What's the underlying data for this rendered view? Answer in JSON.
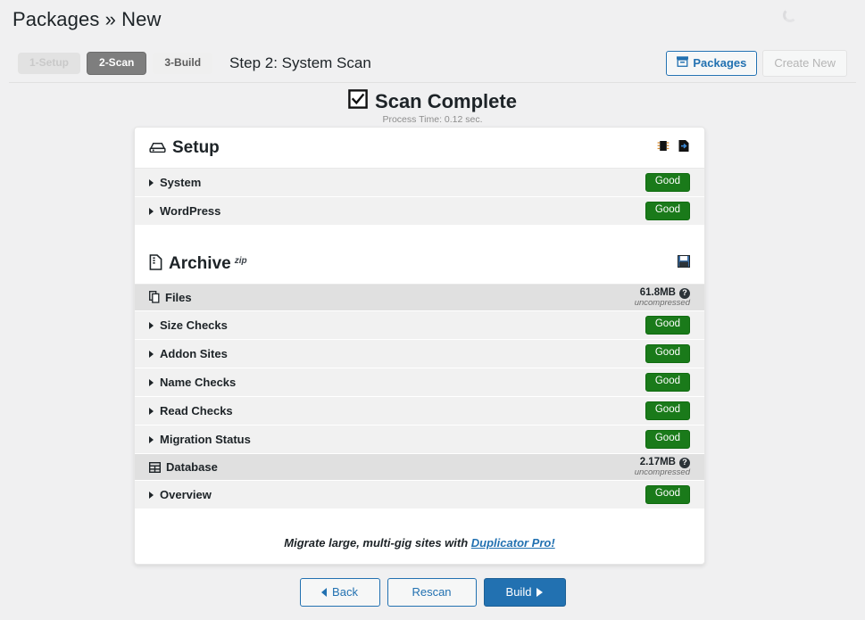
{
  "header": {
    "title": "Packages » New",
    "spinner_icon": "loading-spinner-icon"
  },
  "stepbar": {
    "steps": [
      {
        "label": "1-Setup",
        "state": "done"
      },
      {
        "label": "2-Scan",
        "state": "active"
      },
      {
        "label": "3-Build",
        "state": "todo"
      }
    ],
    "step_title": "Step 2: System Scan",
    "packages_button": {
      "label": "Packages",
      "icon": "archive-box-icon"
    },
    "create_new_button": {
      "label": "Create New"
    }
  },
  "scan_status": {
    "icon": "checkbox-checked-icon",
    "title": "Scan Complete",
    "subtitle": "Process Time: 0.12 sec."
  },
  "setup_section": {
    "title": "Setup",
    "icon": "server-icon",
    "tools": [
      {
        "icon": "chip-icon",
        "name": "system-info-icon"
      },
      {
        "icon": "file-export-icon",
        "name": "export-log-icon"
      }
    ],
    "rows": [
      {
        "label": "System",
        "status": "Good"
      },
      {
        "label": "WordPress",
        "status": "Good"
      }
    ]
  },
  "archive_section": {
    "title": "Archive",
    "superscript": "zip",
    "icon": "file-zip-icon",
    "tools": [
      {
        "icon": "floppy-save-icon",
        "name": "save-archive-icon"
      }
    ],
    "files_group": {
      "label": "Files",
      "icon": "copy-files-icon",
      "size": "61.8MB",
      "size_note": "uncompressed",
      "help_icon": "help-circle-icon"
    },
    "files_rows": [
      {
        "label": "Size Checks",
        "status": "Good"
      },
      {
        "label": "Addon Sites",
        "status": "Good"
      },
      {
        "label": "Name Checks",
        "status": "Good"
      },
      {
        "label": "Read Checks",
        "status": "Good"
      },
      {
        "label": "Migration Status",
        "status": "Good"
      }
    ],
    "database_group": {
      "label": "Database",
      "icon": "table-grid-icon",
      "size": "2.17MB",
      "size_note": "uncompressed",
      "help_icon": "help-circle-icon"
    },
    "database_rows": [
      {
        "label": "Overview",
        "status": "Good"
      }
    ]
  },
  "promo": {
    "text_before": "Migrate large, multi-gig sites with ",
    "link_label": "Duplicator Pro!"
  },
  "footer": {
    "back_label": "Back",
    "rescan_label": "Rescan",
    "build_label": "Build"
  },
  "colors": {
    "page_bg": "#f0f0f1",
    "accent_blue": "#2271b1",
    "good_green": "#1a7a1a",
    "row_bg": "#f1f1f1",
    "group_bg": "#e0e0e0"
  }
}
